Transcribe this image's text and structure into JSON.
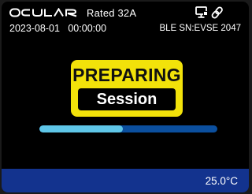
{
  "header": {
    "brand": "OCULAR",
    "rated": "Rated  32A",
    "datetime": "2023-08-01   00:00:00",
    "ble_sn": "BLE SN:EVSE 2047",
    "status_icons": [
      "monitor-icon",
      "link-icon"
    ]
  },
  "status": {
    "title": "PREPARING",
    "subtitle": "Session"
  },
  "progress": {
    "fraction": 0.47
  },
  "footer": {
    "temperature": "25.0°C"
  },
  "colors": {
    "accent_yellow": "#f2e20a",
    "progress_fill": "#5fc6e8",
    "progress_track": "#0b4f9e",
    "footer_bar": "#13338e"
  }
}
